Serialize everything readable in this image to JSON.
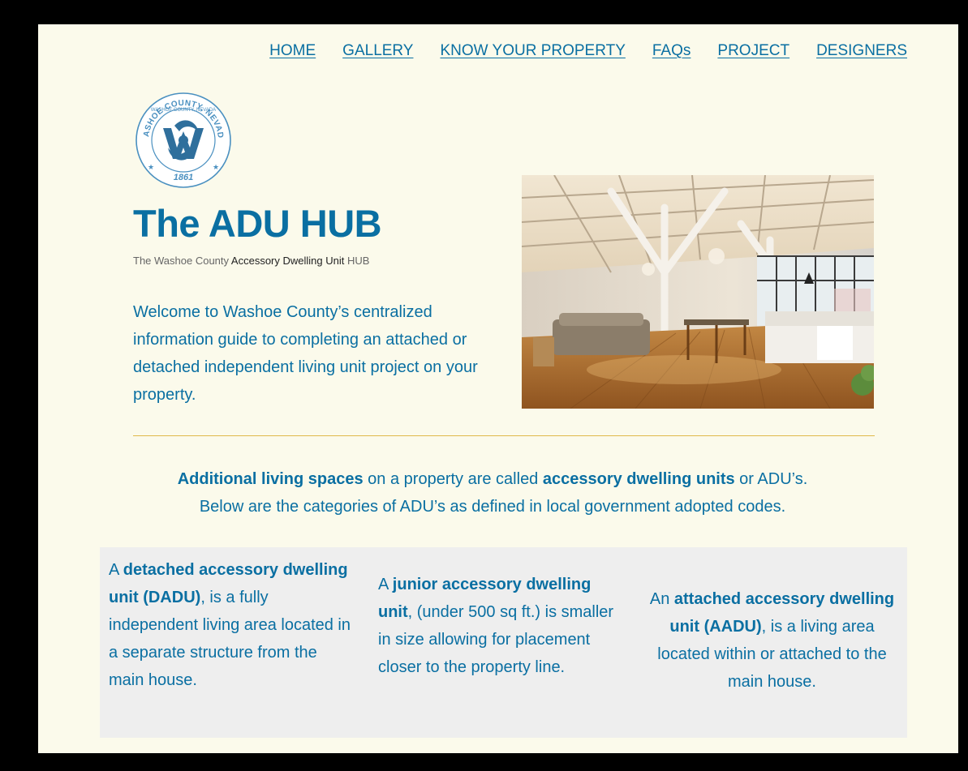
{
  "nav": {
    "items": [
      {
        "label": "HOME"
      },
      {
        "label": "GALLERY"
      },
      {
        "label": "KNOW YOUR PROPERTY"
      },
      {
        "label": "FAQs"
      },
      {
        "label": "PROJECT"
      },
      {
        "label": "DESIGNERS"
      }
    ]
  },
  "logo": {
    "top_text": "WASHOE COUNTY, NEVADA",
    "year": "1861"
  },
  "hero": {
    "title": "The ADU HUB",
    "tagline_part1": "The Washoe County ",
    "tagline_bold": "Accessory Dwelling Unit",
    "tagline_part2": " HUB",
    "welcome": "Welcome to Washoe County’s centralized information guide to completing an attached or detached independent living unit project on your property."
  },
  "intro": {
    "b1": "Additional living spaces",
    "t1": " on a property are called ",
    "b2": "accessory dwelling units",
    "t2": " or ADU’s.",
    "line2": "Below are the categories of ADU’s as defined in local government adopted codes."
  },
  "cards": [
    {
      "pre": "A ",
      "bold": "detached accessory dwelling unit (DADU)",
      "post": ", is a fully independent living area located in a separate structure from the main house."
    },
    {
      "pre": "A ",
      "bold": "junior accessory dwelling unit",
      "post": ", (under 500 sq ft.) is smaller in size allowing for placement closer to the property line."
    },
    {
      "pre": "An ",
      "bold": "attached accessory dwelling unit (AADU)",
      "post": ", is a living area located within or attached to the main house."
    }
  ],
  "colors": {
    "accent": "#0a6fa2",
    "background": "#fbfaeb",
    "divider": "#e0b84a",
    "card_bg": "#eeeeee"
  }
}
